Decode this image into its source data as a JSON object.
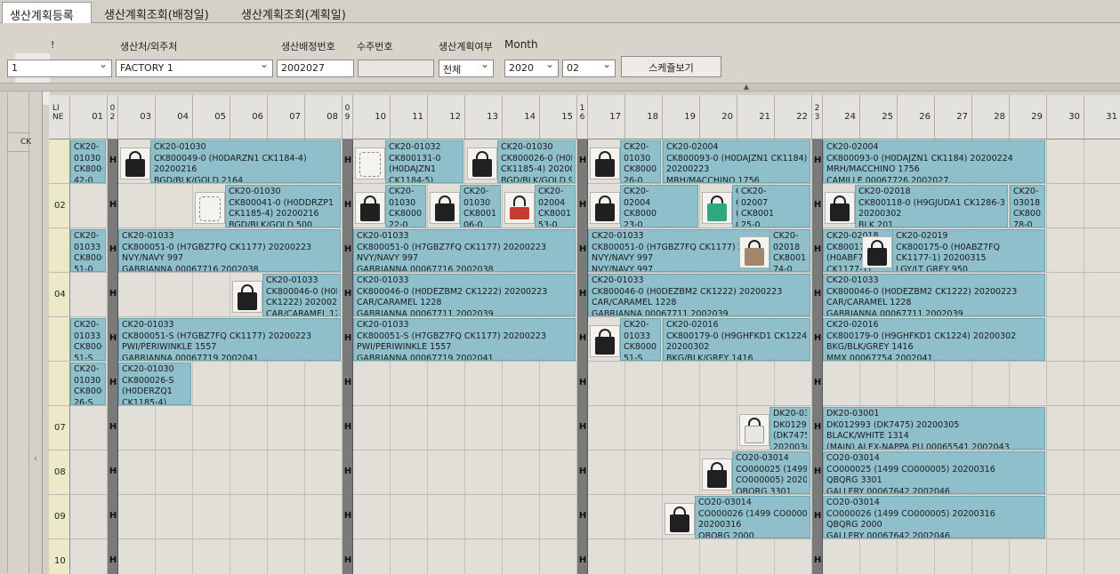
{
  "tabs": [
    {
      "label": "생산계획등록"
    },
    {
      "label": "생산계획조회(배정일)"
    },
    {
      "label": "생산계획조회(계획일)"
    }
  ],
  "filters": {
    "label_partial": "!",
    "factory_label": "생산처/외주처",
    "factory_value": "FACTORY 1",
    "alloc_no_label": "생산배정번호",
    "alloc_no_value": "2002027",
    "order_no_label": "수주번호",
    "order_no_value": "",
    "plan_flag_label": "생산계획여부",
    "plan_flag_value": "전체",
    "month_label": "Month",
    "year_value": "2020",
    "month_value": "02",
    "schedule_button": "스케쥴보기",
    "first_select_value": "1"
  },
  "left_panel": {
    "row_label": "CK"
  },
  "grid": {
    "line_header": "LI NE",
    "hmark": "H",
    "rows": [
      "",
      "02",
      "",
      "04",
      "",
      "",
      "07",
      "08",
      "09",
      "10"
    ],
    "bars": [
      {
        "name": "line1-bar-a",
        "lines": [
          "CK20-",
          "01030",
          "CK8000",
          "42-0"
        ]
      },
      {
        "name": "line1-bar-b",
        "lines": [
          "CK20-01030",
          "CK800049-0  (H0DARZN1 CK1184-4)",
          "20200216",
          "BGD/BLK/GOLD 2164"
        ]
      },
      {
        "name": "line1-bar-c",
        "lines": [
          "CK20-01032",
          "CK800131-0",
          "(H0DAJZN1",
          "CK1184-5)"
        ]
      },
      {
        "name": "line1-bar-d",
        "lines": [
          "CK20-01030",
          "CK800026-0  (H0DERZQ1",
          "CK1185-4)  20200216",
          "BGD/BLK/GOLD 983"
        ]
      },
      {
        "name": "line1-bar-e",
        "lines": [
          "CK20-",
          "01030",
          "CK8000",
          "26-0"
        ]
      },
      {
        "name": "line1-bar-f",
        "lines": [
          "CK20-02004",
          "CK800093-0  (H0DAJZN1 CK1184)",
          "20200223",
          "MRH/MACCHINO 1756"
        ]
      },
      {
        "name": "line1-bar-g",
        "lines": [
          "CK20-02004",
          "CK800093-0  (H0DAJZN1 CK1184)   20200224",
          "MRH/MACCHINO 1756",
          "CAMILLE  00067726 2002027"
        ]
      },
      {
        "name": "line2-bar-a",
        "lines": [
          "CK20-01030",
          "CK800041-0  (H0DDRZP1",
          "CK1185-4)  20200216",
          "BGD/BLK/GOLD 500"
        ]
      },
      {
        "name": "line2-bar-b",
        "lines": [
          "CK20-",
          "01030",
          "CK8000",
          "22-0"
        ]
      },
      {
        "name": "line2-bar-c",
        "lines": [
          "CK20-",
          "01030",
          "CK8001",
          "06-0"
        ]
      },
      {
        "name": "line2-bar-d",
        "lines": [
          "CK20-",
          "02004",
          "CK8001",
          "53-0"
        ]
      },
      {
        "name": "line2-bar-e",
        "lines": [
          "CK20-",
          "02004",
          "CK8000",
          "23-0"
        ]
      },
      {
        "name": "line2-bar-f",
        "lines": [
          "CK20-02007",
          "CK800117-0",
          "(H9GJUDA1",
          "CK1286-3)"
        ]
      },
      {
        "name": "line2-bar-g",
        "lines": [
          "CK20-",
          "02007",
          "CK8001",
          "25-0"
        ]
      },
      {
        "name": "line2-bar-h",
        "lines": [
          "CK20-02018",
          "CK800118-0  (H9GJUDA1 CK1286-3)",
          "20200302",
          "BLK 201"
        ]
      },
      {
        "name": "line2-bar-i",
        "lines": [
          "CK20-",
          "03018",
          "CK8002",
          "78-0"
        ]
      },
      {
        "name": "line3-bar-a",
        "lines": [
          "CK20-",
          "01033",
          "CK8000",
          "51-0"
        ]
      },
      {
        "name": "line3-bar-b",
        "lines": [
          "CK20-01033",
          "CK800051-0  (H7GBZ7FQ CK1177)   20200223",
          "NVY/NAVY 997",
          "GABRIANNA  00067716 2002038"
        ]
      },
      {
        "name": "line3-bar-c",
        "lines": [
          "CK20-01033",
          "CK800051-0  (H7GBZ7FQ CK1177)   20200223",
          "NVY/NAVY 997",
          "GABRIANNA  00067716 2002038"
        ]
      },
      {
        "name": "line3-bar-d",
        "lines": [
          "CK20-01033",
          "CK800051-0  (H7GBZ7FQ CK1177)   20200223",
          "NVY/NAVY 997",
          "NVY/NAVY 997"
        ]
      },
      {
        "name": "line3-bar-e",
        "lines": [
          "CK20-",
          "02018",
          "CK8001",
          "74-0"
        ]
      },
      {
        "name": "line3-bar-f",
        "lines": [
          "CK20-02018",
          "CK800174-0",
          "(H0ABF7FQ",
          "CK1177-1)"
        ]
      },
      {
        "name": "line3-bar-g",
        "lines": [
          "CK20-02019",
          "CK800175-0  (H0ABZ7FQ",
          "CK1177-1)   20200315",
          "LGY/LT GREY 950"
        ]
      },
      {
        "name": "line4-bar-a",
        "lines": [
          "CK20-01033",
          "CK800046-0  (H0DEZBM2",
          "CK1222)     20200223",
          "CAR/CARAMEL 1228"
        ]
      },
      {
        "name": "line4-bar-b",
        "lines": [
          "CK20-01033",
          "CK800046-0  (H0DEZBM2 CK1222)   20200223",
          "CAR/CARAMEL 1228",
          "GABRIANNA  00067711 2002039"
        ]
      },
      {
        "name": "line4-bar-c",
        "lines": [
          "CK20-01033",
          "CK800046-0  (H0DEZBM2 CK1222)   20200223",
          "CAR/CARAMEL 1228",
          "GABRIANNA  00067711 2002039"
        ]
      },
      {
        "name": "line4-bar-d",
        "lines": [
          "CK20-01033",
          "CK800046-0  (H0DEZBM2 CK1222)   20200223",
          "CAR/CARAMEL 1228",
          "GABRIANNA  00067711 2002039"
        ]
      },
      {
        "name": "line5-bar-a",
        "lines": [
          "CK20-",
          "01033",
          "CK8000",
          "51-S"
        ]
      },
      {
        "name": "line5-bar-b",
        "lines": [
          "CK20-01033",
          "CK800051-S  (H7GBZ7FQ CK1177)   20200223",
          "PWI/PERIWINKLE 1557",
          "GABRIANNA  00067719 2002041"
        ]
      },
      {
        "name": "line5-bar-c",
        "lines": [
          "CK20-01033",
          "CK800051-S  (H7GBZ7FQ CK1177)   20200223",
          "PWI/PERIWINKLE 1557",
          "GABRIANNA  00067719 2002041"
        ]
      },
      {
        "name": "line5-bar-d",
        "lines": [
          "CK20-",
          "01033",
          "CK8000",
          "51-S"
        ]
      },
      {
        "name": "line5-bar-e",
        "lines": [
          "CK20-02016",
          "CK800179-0  (H9GHFKD1 CK1224)",
          "20200302",
          "BKG/BLK/GREY 1416"
        ]
      },
      {
        "name": "line5-bar-f",
        "lines": [
          "CK20-02016",
          "CK800179-0  (H9GHFKD1 CK1224)   20200302",
          "BKG/BLK/GREY 1416",
          "MMX  00067754 2002041"
        ]
      },
      {
        "name": "line6-bar-a",
        "lines": [
          "CK20-",
          "01030",
          "CK8000",
          "26-S"
        ]
      },
      {
        "name": "line6-bar-b",
        "lines": [
          "CK20-01030",
          "CK800026-S",
          "(H0DERZQ1",
          "CK1185-4)"
        ]
      },
      {
        "name": "line7-bar-a",
        "lines": [
          "DK20-03001",
          "DK012993",
          "(DK7475)",
          "20200305"
        ]
      },
      {
        "name": "line7-bar-b",
        "lines": [
          "DK20-03001",
          "DK012993  (DK7475)   20200305",
          "BLACK/WHITE 1314",
          "(MAIN) ALEX-NAPPA PU  00065541 2002043"
        ]
      },
      {
        "name": "line8-bar-a",
        "lines": [
          "CO20-03014",
          "CO000025  (1499",
          "CO000005)  20200316",
          "QBQRG 3301"
        ]
      },
      {
        "name": "line8-bar-b",
        "lines": [
          "CO20-03014",
          "CO000025  (1499 CO000005)   20200316",
          "QBQRG 3301",
          "GALLERY  00067642 2002046"
        ]
      },
      {
        "name": "line9-bar-a",
        "lines": [
          "CO20-03014",
          "CO000026  (1499 CO000005)",
          "20200316",
          "QBQRG 2000"
        ]
      },
      {
        "name": "line9-bar-b",
        "lines": [
          "CO20-03014",
          "CO000026  (1499 CO000005)   20200316",
          "QBQRG 2000",
          "GALLERY  00067642 2002046"
        ]
      }
    ]
  }
}
